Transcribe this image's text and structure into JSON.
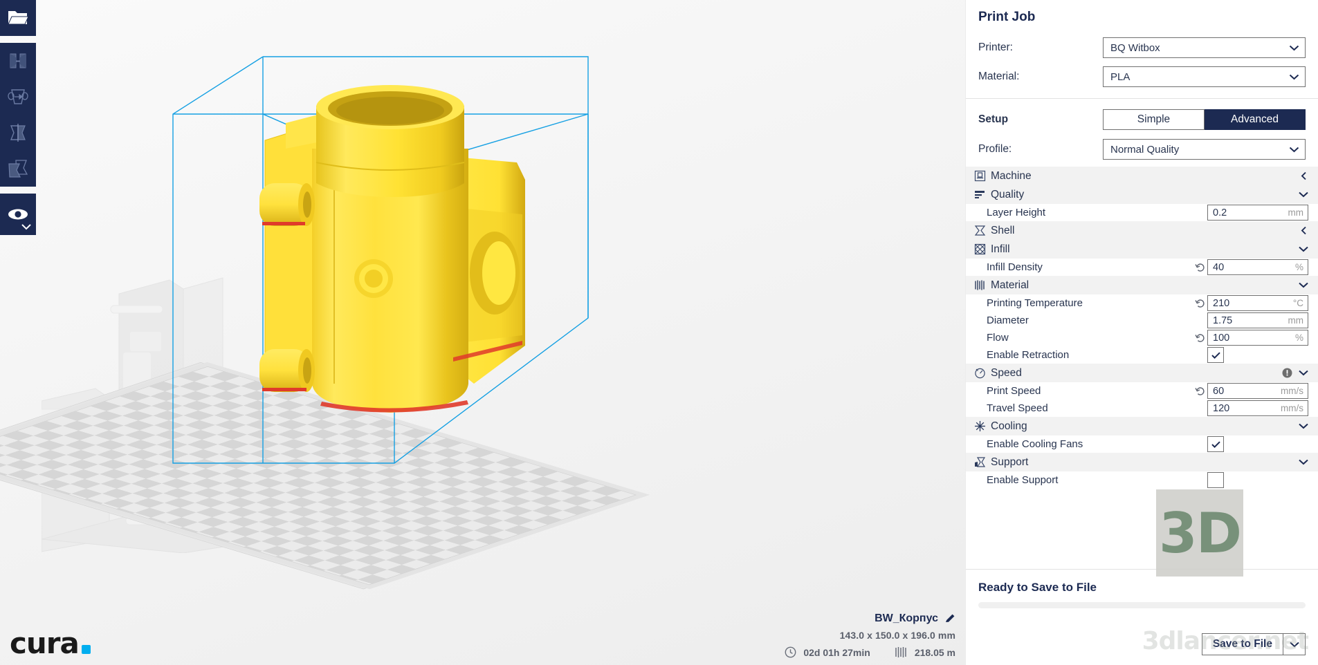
{
  "toolbar": {
    "items": [
      {
        "name": "open-file",
        "icon": "folder-open-icon",
        "active": true
      },
      {
        "name": "move",
        "icon": "move-tool-icon",
        "active": false
      },
      {
        "name": "scale",
        "icon": "scale-tool-icon",
        "active": false
      },
      {
        "name": "rotate",
        "icon": "rotate-tool-icon",
        "active": false
      },
      {
        "name": "mirror",
        "icon": "mirror-tool-icon",
        "active": false
      }
    ],
    "view_mode": {
      "name": "view-mode",
      "icon": "eye-icon",
      "chevron": "chevron-down-icon"
    }
  },
  "logo": {
    "word": "cura",
    "dot_color": "#00aeef"
  },
  "model_info": {
    "name": "BW_Корпус",
    "edit_icon": "pencil-icon",
    "dimensions": "143.0 x 150.0 x 196.0 mm",
    "time_icon": "clock-icon",
    "print_time": "02d 01h 27min",
    "material_icon": "filament-icon",
    "material_length": "218.05 m"
  },
  "print_job": {
    "title": "Print Job",
    "printer_label": "Printer:",
    "printer_value": "BQ Witbox",
    "material_label": "Material:",
    "material_value": "PLA"
  },
  "setup": {
    "title": "Setup",
    "tabs": [
      {
        "label": "Simple",
        "active": false
      },
      {
        "label": "Advanced",
        "active": true
      }
    ],
    "profile_label": "Profile:",
    "profile_value": "Normal Quality"
  },
  "settings": [
    {
      "type": "category",
      "label": "Machine",
      "icon": "machine-icon",
      "expanded": false,
      "chevron": "chevron-left-icon",
      "warning": false
    },
    {
      "type": "category",
      "label": "Quality",
      "icon": "quality-icon",
      "expanded": true,
      "chevron": "chevron-down-icon",
      "warning": false
    },
    {
      "type": "setting",
      "label": "Layer Height",
      "value": "0.2",
      "unit": "mm",
      "revert": false,
      "control": "text"
    },
    {
      "type": "category",
      "label": "Shell",
      "icon": "shell-icon",
      "expanded": false,
      "chevron": "chevron-left-icon",
      "warning": false
    },
    {
      "type": "category",
      "label": "Infill",
      "icon": "infill-icon",
      "expanded": true,
      "chevron": "chevron-down-icon",
      "warning": false
    },
    {
      "type": "setting",
      "label": "Infill Density",
      "value": "40",
      "unit": "%",
      "revert": true,
      "control": "text"
    },
    {
      "type": "category",
      "label": "Material",
      "icon": "material-icon",
      "expanded": true,
      "chevron": "chevron-down-icon",
      "warning": false
    },
    {
      "type": "setting",
      "label": "Printing Temperature",
      "value": "210",
      "unit": "°C",
      "revert": true,
      "control": "text"
    },
    {
      "type": "setting",
      "label": "Diameter",
      "value": "1.75",
      "unit": "mm",
      "revert": false,
      "control": "text"
    },
    {
      "type": "setting",
      "label": "Flow",
      "value": "100",
      "unit": "%",
      "revert": true,
      "control": "text"
    },
    {
      "type": "setting",
      "label": "Enable Retraction",
      "value": "",
      "unit": "",
      "revert": false,
      "control": "checkbox",
      "checked": true
    },
    {
      "type": "category",
      "label": "Speed",
      "icon": "speed-icon",
      "expanded": true,
      "chevron": "chevron-down-icon",
      "warning": true,
      "warning_icon": "warning-icon"
    },
    {
      "type": "setting",
      "label": "Print Speed",
      "value": "60",
      "unit": "mm/s",
      "revert": true,
      "control": "text"
    },
    {
      "type": "setting",
      "label": "Travel Speed",
      "value": "120",
      "unit": "mm/s",
      "revert": false,
      "control": "text"
    },
    {
      "type": "category",
      "label": "Cooling",
      "icon": "cooling-icon",
      "expanded": true,
      "chevron": "chevron-down-icon",
      "warning": false
    },
    {
      "type": "setting",
      "label": "Enable Cooling Fans",
      "value": "",
      "unit": "",
      "revert": false,
      "control": "checkbox",
      "checked": true
    },
    {
      "type": "category",
      "label": "Support",
      "icon": "support-icon",
      "expanded": true,
      "chevron": "chevron-down-icon",
      "warning": false
    },
    {
      "type": "setting",
      "label": "Enable Support",
      "value": "",
      "unit": "",
      "revert": false,
      "control": "checkbox",
      "checked": false
    }
  ],
  "action": {
    "ready_text": "Ready to Save to File",
    "progress_percent": 0,
    "save_label": "Save to File",
    "save_more_icon": "chevron-down-icon"
  },
  "watermarks": {
    "badge": "3D",
    "site": "3dlancer.net"
  },
  "colors": {
    "brand_navy": "#1c2a52",
    "accent_cyan": "#00aeef",
    "model_yellow": "#ffe13d",
    "bbox_blue": "#15a0e3",
    "panel_bg": "#ffffff",
    "viewport_bg": "#f5f5f5",
    "category_bg": "#f2f2f2"
  }
}
